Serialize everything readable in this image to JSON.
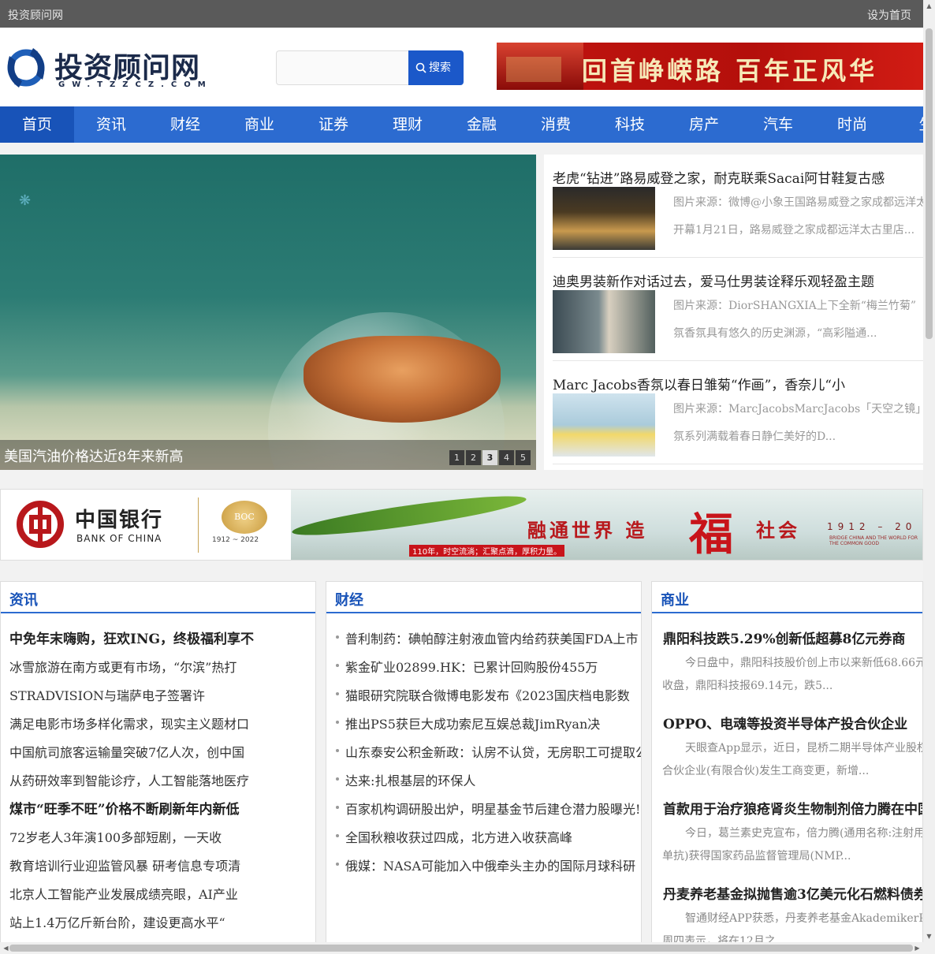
{
  "topbar": {
    "site_name": "投资顾问网",
    "set_home": "设为首页"
  },
  "logo": {
    "title": "投资顾问网",
    "domain": "GW.TZZCZ.COM"
  },
  "search": {
    "placeholder": "",
    "button": "搜索"
  },
  "banner1": {
    "text": "回首峥嵘路 百年正风华"
  },
  "nav": [
    "首页",
    "资讯",
    "财经",
    "商业",
    "证券",
    "理财",
    "金融",
    "消费",
    "科技",
    "房产",
    "汽车",
    "时尚",
    "生"
  ],
  "slider": {
    "caption": "美国汽油价格达近8年来新高",
    "pages": [
      "1",
      "2",
      "3",
      "4",
      "5"
    ],
    "active_page": 3
  },
  "news_cards": [
    {
      "title": "老虎“钻进”路易威登之家，耐克联乘Sacai阿甘鞋复古感",
      "line1": "图片来源：微博@小象王国路易威登之家成都远洋太",
      "line2": "开幕1月21日，路易威登之家成都远洋太古里店..."
    },
    {
      "title": "迪奥男装新作对话过去，爱马仕男装诠释乐观轻盈主题",
      "line1": "图片来源：DiorSHANGXIA上下全新“梅兰竹菊”",
      "line2": "氛香氛具有悠久的历史渊源，“高彩隘通..."
    },
    {
      "title": "Marc Jacobs香氛以春日雏菊“作画”，香奈儿“小",
      "line1": "图片来源：MarcJacobsMarcJacobs「天空之镜」限",
      "line2": "氛系列满载着春日静仁美好的D..."
    }
  ],
  "banner2": {
    "bank_zh": "中国银行",
    "bank_en": "BANK OF CHINA",
    "years": "1912 ~ 2022",
    "badge": "BOC",
    "slogan_a": "融通世界 造",
    "slogan_fu": "福",
    "slogan_b": "社会",
    "right_years": "1912 – 20",
    "right_en": "BRIDGE CHINA AND THE WORLD FOR THE COMMON GOOD",
    "sub": "110年，时空流淌；汇聚点滴，厚积力量。"
  },
  "col_news": {
    "title": "资讯",
    "items": [
      {
        "text": "中免年末嗨购，狂欢ING，终极福利享不",
        "bold": true
      },
      {
        "text": "冰雪旅游在南方或更有市场，“尔滨”热打",
        "bold": false
      },
      {
        "text": "STRADVISION与瑞萨电子签署许",
        "bold": false
      },
      {
        "text": "满足电影市场多样化需求，现实主义题材口",
        "bold": false
      },
      {
        "text": "中国航司旅客运输量突破7亿人次，创中国",
        "bold": false
      },
      {
        "text": "从药研效率到智能诊疗，人工智能落地医疗",
        "bold": false
      },
      {
        "text": "煤市“旺季不旺”价格不断刷新年内新低",
        "bold": true
      },
      {
        "text": "72岁老人3年演100多部短剧，一天收",
        "bold": false
      },
      {
        "text": "教育培训行业迎监管风暴 研考信息专项清",
        "bold": false
      },
      {
        "text": "北京人工智能产业发展成绩亮眼，AI产业",
        "bold": false
      },
      {
        "text": "站上1.4万亿斤新台阶，建设更高水平“",
        "bold": false
      }
    ]
  },
  "col_finance": {
    "title": "财经",
    "items": [
      "普利制药：碘帕醇注射液血管内给药获美国FDA上市",
      "紫金矿业02899.HK：已累计回购股份455万",
      "猫眼研究院联合微博电影发布《2023国庆档电影数",
      "推出PS5获巨大成功索尼互娱总裁JimRyan决",
      "山东泰安公积金新政：认房不认贷，无房职工可提取公",
      "达来:扎根基层的环保人",
      "百家机构调研股出炉，明星基金节后建仓潜力股曝光!",
      "全国秋粮收获过四成，北方进入收获高峰",
      "俄媒：NASA可能加入中俄牵头主办的国际月球科研"
    ]
  },
  "col_business": {
    "title": "商业",
    "items": [
      {
        "title": "鼎阳科技跌5.29%创新低超募8亿元券商",
        "d1": "今日盘中，鼎阳科技股价创上市以来新低68.66元",
        "d2": "收盘，鼎阳科技报69.14元，跌5..."
      },
      {
        "title": "OPPO、电魂等投资半导体产投合伙企业",
        "d1": "天眼查App显示，近日，昆桥二期半导体产业股权",
        "d2": "合伙企业(有限合伙)发生工商变更，新增..."
      },
      {
        "title": "首款用于治疗狼疮肾炎生物制剂倍力腾在中国",
        "d1": "今日，葛兰素史克宣布，倍力腾(通用名称:注射用",
        "d2": "单抗)获得国家药品监督管理局(NMP..."
      },
      {
        "title": "丹麦养老基金拟抛售逾3亿美元化石燃料债券",
        "d1": "智通财经APP获悉，丹麦养老基金AkademikerP",
        "d2": "周四表示，将在12月之..."
      }
    ]
  }
}
